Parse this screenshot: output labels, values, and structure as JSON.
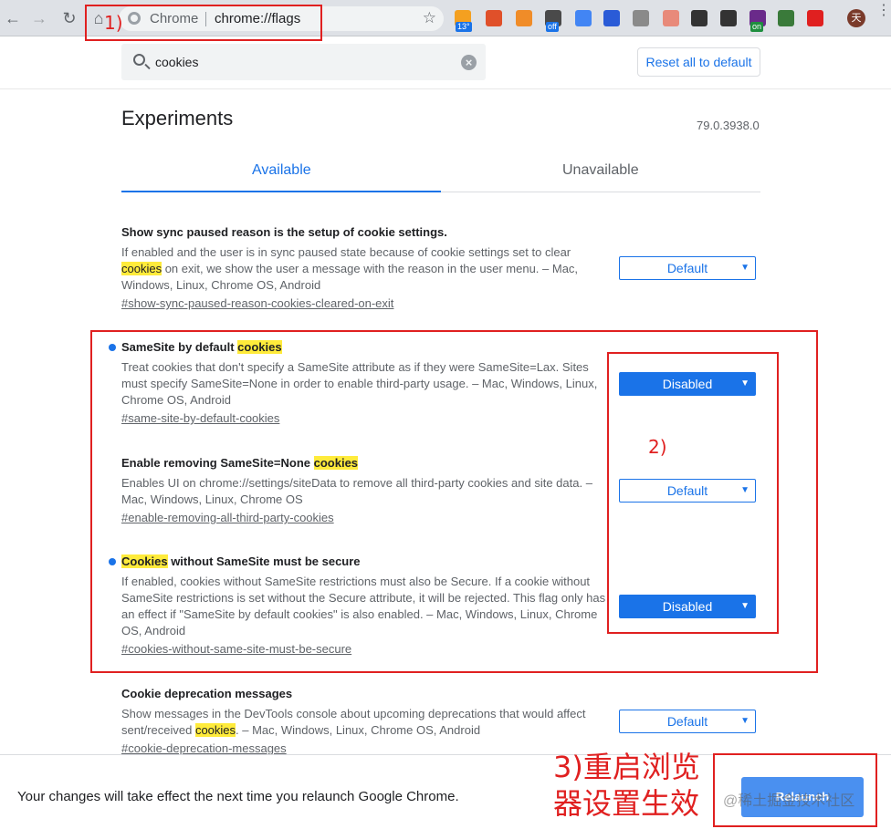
{
  "browser": {
    "omnibox_label": "Chrome",
    "url": "chrome://flags",
    "extensions": [
      {
        "icon": "weather-icon",
        "badge": "13°",
        "color": "#f4a020",
        "badge_color": "#1a73e8"
      },
      {
        "icon": "red-ext-icon",
        "badge": "",
        "color": "#e0502a",
        "badge_color": ""
      },
      {
        "icon": "orange-ext-icon",
        "badge": "",
        "color": "#f08c28",
        "badge_color": ""
      },
      {
        "icon": "off-ext-icon",
        "badge": "off",
        "color": "#4a4a4a",
        "badge_color": "#1a73e8"
      },
      {
        "icon": "translate-icon",
        "badge": "",
        "color": "#4285f4",
        "badge_color": ""
      },
      {
        "icon": "grid-ext-icon",
        "badge": "",
        "color": "#2a5bd7",
        "badge_color": ""
      },
      {
        "icon": "g-ext-icon",
        "badge": "",
        "color": "#8a8a8a",
        "badge_color": ""
      },
      {
        "icon": "box-ext-icon",
        "badge": "",
        "color": "#e88a7a",
        "badge_color": ""
      },
      {
        "icon": "globe-ext-icon",
        "badge": "",
        "color": "#333333",
        "badge_color": ""
      },
      {
        "icon": "qr-code-icon",
        "badge": "",
        "color": "#333333",
        "badge_color": ""
      },
      {
        "icon": "on-ext-icon",
        "badge": "on",
        "color": "#6a2a8a",
        "badge_color": "#1e8e3e"
      },
      {
        "icon": "image-ext-icon",
        "badge": "",
        "color": "#3a7a3a",
        "badge_color": ""
      },
      {
        "icon": "opera-ext-icon",
        "badge": "",
        "color": "#e02020",
        "badge_color": ""
      }
    ],
    "profile_initial": "天"
  },
  "search": {
    "value": "cookies"
  },
  "reset_label": "Reset all to default",
  "title": "Experiments",
  "version": "79.0.3938.0",
  "tabs": {
    "available": "Available",
    "unavailable": "Unavailable"
  },
  "experiments": [
    {
      "title_parts": [
        "Show sync paused reason is the setup of cookie settings.",
        ""
      ],
      "desc_parts": [
        "If enabled and the user is in sync paused state because of cookie settings set to clear ",
        "cookies",
        " on exit, we show the user a message with the reason in the user menu. – Mac, Windows, Linux, Chrome OS, Android"
      ],
      "link": "#show-sync-paused-reason-cookies-cleared-on-exit",
      "value": "Default"
    },
    {
      "title_parts": [
        "SameSite by default ",
        "cookies"
      ],
      "desc_parts": [
        "Treat cookies that don't specify a SameSite attribute as if they were SameSite=Lax. Sites must specify SameSite=None in order to enable third-party usage. – Mac, Windows, Linux, Chrome OS, Android",
        "",
        ""
      ],
      "link": "#same-site-by-default-cookies",
      "value": "Disabled"
    },
    {
      "title_parts": [
        "Enable removing SameSite=None ",
        "cookies"
      ],
      "desc_parts": [
        "Enables UI on chrome://settings/siteData to remove all third-party cookies and site data. – Mac, Windows, Linux, Chrome OS",
        "",
        ""
      ],
      "link": "#enable-removing-all-third-party-cookies",
      "value": "Default"
    },
    {
      "title_parts": [
        "Cookies",
        " without SameSite must be secure"
      ],
      "desc_parts": [
        "If enabled, cookies without SameSite restrictions must also be Secure. If a cookie without SameSite restrictions is set without the Secure attribute, it will be rejected. This flag only has an effect if \"SameSite by default cookies\" is also enabled. – Mac, Windows, Linux, Chrome OS, Android",
        "",
        ""
      ],
      "link": "#cookies-without-same-site-must-be-secure",
      "value": "Disabled"
    },
    {
      "title_parts": [
        "Cookie deprecation messages",
        ""
      ],
      "desc_parts": [
        "Show messages in the DevTools console about upcoming deprecations that would affect sent/received ",
        "cookies",
        ". – Mac, Windows, Linux, Chrome OS, Android"
      ],
      "link": "#cookie-deprecation-messages",
      "value": "Default"
    }
  ],
  "annotations": {
    "step1": "1)",
    "step2": "2)",
    "step3_line1": "3)重启浏览",
    "step3_line2": "器设置生效"
  },
  "footer": {
    "message": "Your changes will take effect the next time you relaunch Google Chrome.",
    "relaunch": "Relaunch"
  },
  "watermark": "@稀土掘金技术社区"
}
